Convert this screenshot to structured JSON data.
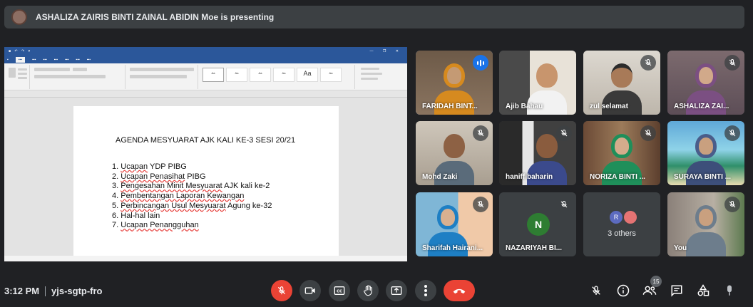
{
  "banner": {
    "text": "ASHALIZA ZAIRIS BINTI ZAINAL ABIDIN Moe is presenting"
  },
  "shared_screen": {
    "document": {
      "title": "AGENDA MESYUARAT AJK KALI KE-3 SESI 20/21",
      "items": [
        {
          "num": "1.",
          "underlined": "Ucapan",
          "rest": " YDP PIBG"
        },
        {
          "num": "2.",
          "underlined": "Ucapan Penasihat",
          "rest": " PIBG"
        },
        {
          "num": "3.",
          "underlined": "Pengesahan Minit Mesyuarat",
          "rest": " AJK kali ke-2"
        },
        {
          "num": "4.",
          "underlined": "Pembentangan Laporan Kewangan",
          "rest": ""
        },
        {
          "num": "5.",
          "underlined": "Perbincangan Usul Mesyuarat",
          "rest": " Agung ke-32"
        },
        {
          "num": "6.",
          "underlined": "",
          "rest": "Hal-hal lain"
        },
        {
          "num": "7.",
          "underlined": "Ucapan Penangguhan",
          "rest": ""
        }
      ]
    }
  },
  "participants": [
    {
      "name": "FARIDAH BINT...",
      "state": "speaking"
    },
    {
      "name": "Ajib Bahau",
      "state": "mic-on"
    },
    {
      "name": "zul selamat",
      "state": "muted"
    },
    {
      "name": "ASHALIZA ZAI...",
      "state": "muted"
    },
    {
      "name": "Mohd Zaki",
      "state": "muted"
    },
    {
      "name": "haniff baharin",
      "state": "muted"
    },
    {
      "name": "NORIZA BINTI ...",
      "state": "muted"
    },
    {
      "name": "SURAYA BINTI ...",
      "state": "muted"
    },
    {
      "name": "Sharifah Hairani...",
      "state": "muted"
    },
    {
      "name": "NAZARIYAH BI...",
      "state": "muted",
      "avatar_letter": "N"
    },
    {
      "name": "3 others",
      "avatar_letter": "R"
    },
    {
      "name": "You",
      "state": "muted"
    }
  ],
  "bottom_bar": {
    "time": "3:12 PM",
    "meeting_code": "yjs-sgtp-fro",
    "participant_count": "15"
  },
  "colors": {
    "end_call": "#ea4335",
    "mic_off": "#ea4335",
    "speaking": "#1a73e8",
    "background": "#202124"
  }
}
